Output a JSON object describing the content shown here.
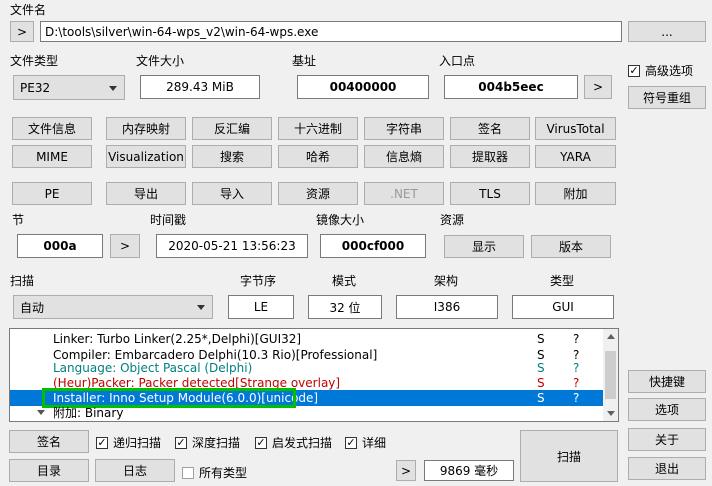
{
  "file": {
    "label": "文件名",
    "nav_label": ">",
    "path": "D:\\tools\\silver\\win-64-wps_v2\\win-64-wps.exe",
    "browse_label": "..."
  },
  "header": {
    "file_type_label": "文件类型",
    "file_type_value": "PE32",
    "file_size_label": "文件大小",
    "file_size_value": "289.43 MiB",
    "base_label": "基址",
    "base_value": "00400000",
    "entry_label": "入口点",
    "entry_value": "004b5eec",
    "entry_nav": ">"
  },
  "side": {
    "advanced_label": "高级选项",
    "advanced_checked": "✓",
    "symbol_label": "符号重组",
    "shortcuts": "快捷键",
    "options": "选项",
    "about": "关于",
    "exit": "退出"
  },
  "tools": {
    "row1": [
      "文件信息",
      "内存映射",
      "反汇编",
      "十六进制",
      "字符串",
      "签名",
      "VirusTotal"
    ],
    "row2": [
      "MIME",
      "Visualization",
      "搜索",
      "哈希",
      "信息熵",
      "提取器",
      "YARA"
    ]
  },
  "pe_tabs": [
    "PE",
    "导出",
    "导入",
    "资源",
    ".NET",
    "TLS",
    "附加"
  ],
  "sections": {
    "section_label": "节",
    "section_value": "000a",
    "section_nav": ">",
    "timestamp_label": "时间戳",
    "timestamp_value": "2020-05-21 13:56:23",
    "image_size_label": "镜像大小",
    "image_size_value": "000cf000",
    "resources_label": "资源",
    "show_label": "显示",
    "version_label": "版本"
  },
  "scan": {
    "scan_label": "扫描",
    "mode_value": "自动",
    "endian_label": "字节序",
    "endian_value": "LE",
    "mode_label": "模式",
    "bits_value": "32 位",
    "arch_label": "架构",
    "arch_value": "I386",
    "type_label": "类型",
    "type_value": "GUI"
  },
  "results": [
    {
      "text": "Linker: Turbo Linker(2.25*,Delphi)[GUI32]",
      "s": "S",
      "q": "?",
      "color": "#000000"
    },
    {
      "text": "Compiler: Embarcadero Delphi(10.3 Rio)[Professional]",
      "s": "S",
      "q": "?",
      "color": "#000000"
    },
    {
      "text": "Language: Object Pascal (Delphi)",
      "s": "S",
      "q": "?",
      "color": "#008080"
    },
    {
      "text": "(Heur)Packer: Packer detected[Strange overlay]",
      "s": "S",
      "q": "?",
      "color": "#c00000"
    },
    {
      "text": "Installer: Inno Setup Module(6.0.0)[unicode]",
      "s": "S",
      "q": "?",
      "color": "#ffffff"
    },
    {
      "text": "附加: Binary",
      "s": "",
      "q": "",
      "color": "#000000"
    }
  ],
  "bottom": {
    "signature_label": "签名",
    "recursive_label": "递归扫描",
    "deep_label": "深度扫描",
    "heuristic_label": "启发式扫描",
    "verbose_label": "详细",
    "directory_label": "目录",
    "log_label": "日志",
    "all_types_label": "所有类型",
    "nav_label": ">",
    "time_value": "9869 毫秒",
    "scan_button": "扫描",
    "check": "✓"
  },
  "colors": {
    "selection": "#0078d7",
    "highlight_box": "#00c000"
  }
}
